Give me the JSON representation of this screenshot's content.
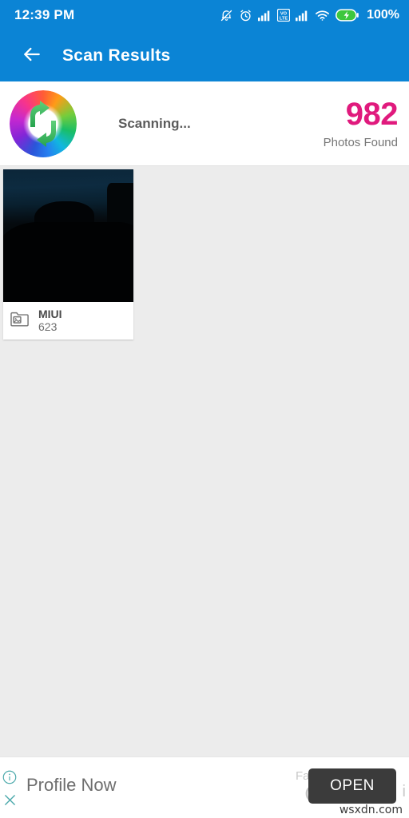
{
  "status_bar": {
    "time": "12:39 PM",
    "battery_percent": "100%",
    "icons": [
      "bell-muted-icon",
      "alarm-clock-icon",
      "signal-bars-icon",
      "volte-icon",
      "signal-bars-2-icon",
      "wifi-icon",
      "battery-charging-icon"
    ],
    "volte_label_top": "VO",
    "volte_label_bottom": "LTE"
  },
  "app_bar": {
    "back_icon": "arrow-left-icon",
    "title": "Scan Results"
  },
  "scan_header": {
    "logo_icon": "app-logo-refresh-icon",
    "status_text": "Scanning...",
    "count": "982",
    "count_label": "Photos Found"
  },
  "folders": [
    {
      "name": "MIUI",
      "count": "623",
      "icon": "folder-image-icon"
    }
  ],
  "ad_banner": {
    "info_icon": "info-circle-icon",
    "close_icon": "close-x-icon",
    "headline": "Profile Now",
    "obscured_small": "Fac",
    "obscured_big": "Co",
    "edge_text": "i",
    "open_label": "OPEN",
    "watermark": "wsxdn.com"
  },
  "colors": {
    "header_blue": "#0b84d5",
    "count_pink": "#e01a7d",
    "ad_badge_teal": "#4ba9ab",
    "ad_button_dark": "#3b3b3b",
    "content_bg": "#ececec"
  }
}
